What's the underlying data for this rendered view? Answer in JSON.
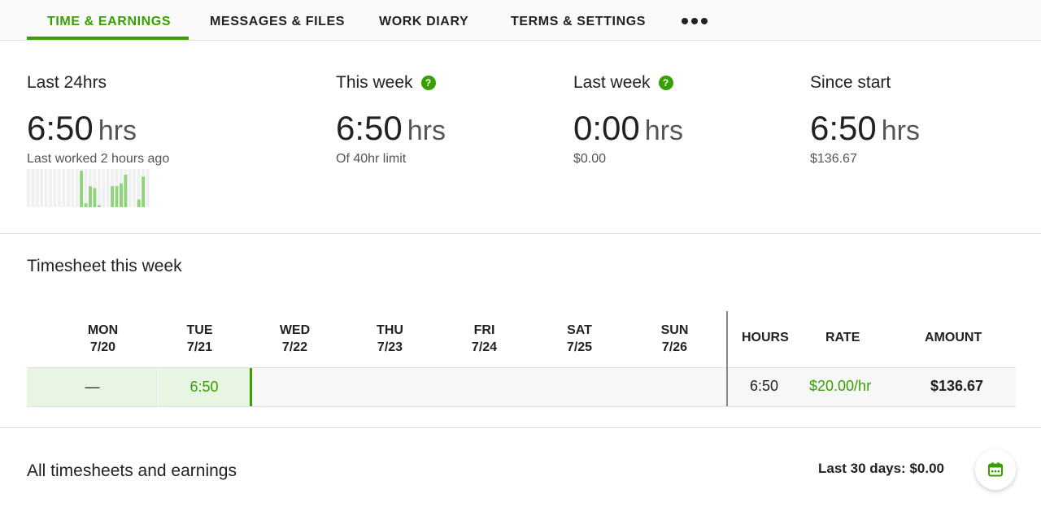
{
  "tabs": [
    {
      "label": "TIME & EARNINGS",
      "active": true
    },
    {
      "label": "MESSAGES & FILES",
      "active": false
    },
    {
      "label": "WORK DIARY",
      "active": false
    },
    {
      "label": "TERMS & SETTINGS",
      "active": false
    }
  ],
  "more_icon": "more-horizontal-icon",
  "stats": {
    "last24": {
      "label": "Last 24hrs",
      "value": "6:50",
      "unit": "hrs",
      "sub": "Last worked 2 hours ago"
    },
    "this_week": {
      "label": "This week",
      "value": "6:50",
      "unit": "hrs",
      "sub": "Of 40hr limit",
      "help_icon": "?"
    },
    "last_week": {
      "label": "Last week",
      "value": "0:00",
      "unit": "hrs",
      "sub": "$0.00",
      "help_icon": "?"
    },
    "since_start": {
      "label": "Since start",
      "value": "6:50",
      "unit": "hrs",
      "sub": "$136.67"
    }
  },
  "activity_sparkline": {
    "levels": [
      0,
      0,
      0,
      0,
      0,
      0,
      0,
      0,
      0,
      0,
      0,
      0,
      0.95,
      0.1,
      0.55,
      0.5,
      0.05,
      0,
      0,
      0.55,
      0.55,
      0.62,
      0.85,
      0,
      0,
      0.2,
      0.8,
      0
    ],
    "active_color": "#8fd37a",
    "empty_color": "#f0f0f0"
  },
  "timesheet": {
    "title": "Timesheet this week",
    "days": [
      {
        "day": "MON",
        "date": "7/20"
      },
      {
        "day": "TUE",
        "date": "7/21"
      },
      {
        "day": "WED",
        "date": "7/22"
      },
      {
        "day": "THU",
        "date": "7/23"
      },
      {
        "day": "FRI",
        "date": "7/24"
      },
      {
        "day": "SAT",
        "date": "7/25"
      },
      {
        "day": "SUN",
        "date": "7/26"
      }
    ],
    "columns": {
      "hours": "HOURS",
      "rate": "RATE",
      "amount": "AMOUNT"
    },
    "row": {
      "mon": "—",
      "tue": "6:50",
      "hours": "6:50",
      "rate": "$20.00/hr",
      "amount": "$136.67"
    }
  },
  "all_timesheets": {
    "title": "All timesheets and earnings",
    "last30": "Last 30 days: $0.00",
    "calendar_icon": "calendar-icon"
  },
  "colors": {
    "accent": "#37a000",
    "highlight": "#e8f5e3"
  }
}
